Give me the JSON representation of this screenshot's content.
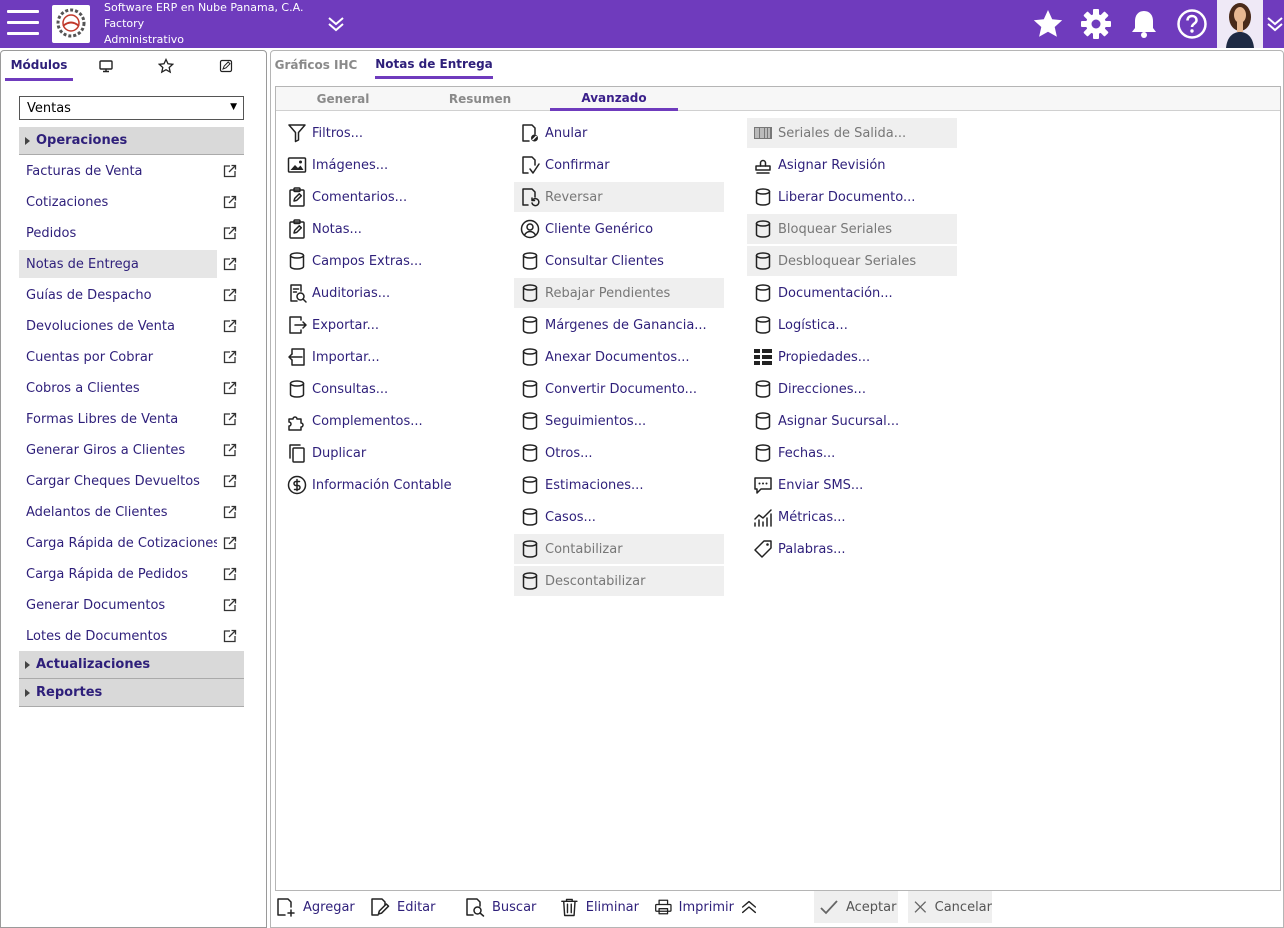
{
  "header": {
    "company_lines": [
      "Software ERP en Nube Panama, C.A.",
      "Factory",
      "Administrativo"
    ],
    "icons": [
      "menu-icon",
      "company-logo",
      "chevron-double-down-icon",
      "star-icon",
      "gear-icon",
      "bell-icon",
      "help-icon",
      "user-avatar",
      "chevron-double-down-icon"
    ],
    "bar_color": "#6f3bbd"
  },
  "left_panel": {
    "tabs": [
      {
        "label": "Módulos",
        "selected": true
      },
      {
        "icon": "monitor-icon"
      },
      {
        "icon": "star-outline-icon"
      },
      {
        "icon": "note-edit-icon"
      }
    ],
    "module_select": "Ventas",
    "sections": [
      {
        "label": "Operaciones",
        "expanded": true
      },
      {
        "label": "Actualizaciones",
        "expanded": false
      },
      {
        "label": "Reportes",
        "expanded": false
      }
    ],
    "items": [
      "Facturas de Venta",
      "Cotizaciones",
      "Pedidos",
      "Notas de Entrega",
      "Guías de Despacho",
      "Devoluciones de Venta",
      "Cuentas por Cobrar",
      "Cobros a Clientes",
      "Formas Libres de Venta",
      "Generar Giros a Clientes",
      "Cargar Cheques Devueltos",
      "Adelantos de Clientes",
      "Carga Rápida de Cotizaciones",
      "Carga Rápida de Pedidos",
      "Generar Documentos",
      "Lotes de Documentos"
    ],
    "selected_item": "Notas de Entrega"
  },
  "main": {
    "tabs": [
      {
        "label": "Gráficos IHC",
        "selected": false
      },
      {
        "label": "Notas de Entrega",
        "selected": true
      }
    ],
    "subtabs": [
      {
        "label": "General",
        "selected": false
      },
      {
        "label": "Resumen",
        "selected": false
      },
      {
        "label": "Avanzado",
        "selected": true
      }
    ],
    "columns": [
      [
        {
          "label": "Filtros...",
          "icon": "filter-icon",
          "disabled": false
        },
        {
          "label": "Imágenes...",
          "icon": "image-icon",
          "disabled": false
        },
        {
          "label": "Comentarios...",
          "icon": "clipboard-edit-icon",
          "disabled": false
        },
        {
          "label": "Notas...",
          "icon": "clipboard-edit-icon",
          "disabled": false
        },
        {
          "label": "Campos Extras...",
          "icon": "database-icon",
          "disabled": false
        },
        {
          "label": "Auditorias...",
          "icon": "audit-search-icon",
          "disabled": false
        },
        {
          "label": "Exportar...",
          "icon": "export-icon",
          "disabled": false
        },
        {
          "label": "Importar...",
          "icon": "import-icon",
          "disabled": false
        },
        {
          "label": "Consultas...",
          "icon": "database-icon",
          "disabled": false
        },
        {
          "label": "Complementos...",
          "icon": "puzzle-icon",
          "disabled": false
        },
        {
          "label": "Duplicar",
          "icon": "copy-icon",
          "disabled": false
        },
        {
          "label": "Información Contable",
          "icon": "dollar-circle-icon",
          "disabled": false
        }
      ],
      [
        {
          "label": "Anular",
          "icon": "document-cancel-icon",
          "disabled": false
        },
        {
          "label": "Confirmar",
          "icon": "document-check-icon",
          "disabled": false
        },
        {
          "label": "Reversar",
          "icon": "document-undo-icon",
          "disabled": true
        },
        {
          "label": "Cliente Genérico",
          "icon": "user-circle-icon",
          "disabled": false
        },
        {
          "label": "Consultar Clientes",
          "icon": "database-icon",
          "disabled": false
        },
        {
          "label": "Rebajar Pendientes",
          "icon": "database-icon",
          "disabled": true
        },
        {
          "label": "Márgenes de Ganancia...",
          "icon": "database-icon",
          "disabled": false
        },
        {
          "label": "Anexar Documentos...",
          "icon": "database-icon",
          "disabled": false
        },
        {
          "label": "Convertir Documento...",
          "icon": "database-icon",
          "disabled": false
        },
        {
          "label": "Seguimientos...",
          "icon": "database-icon",
          "disabled": false
        },
        {
          "label": "Otros...",
          "icon": "database-icon",
          "disabled": false
        },
        {
          "label": "Estimaciones...",
          "icon": "database-icon",
          "disabled": false
        },
        {
          "label": "Casos...",
          "icon": "database-icon",
          "disabled": false
        },
        {
          "label": "Contabilizar",
          "icon": "database-icon",
          "disabled": true
        },
        {
          "label": "Descontabilizar",
          "icon": "database-icon",
          "disabled": true
        }
      ],
      [
        {
          "label": "Seriales de Salida...",
          "icon": "barcode-icon",
          "disabled": true
        },
        {
          "label": "Asignar Revisión",
          "icon": "stamp-icon",
          "disabled": false
        },
        {
          "label": "Liberar Documento...",
          "icon": "database-icon",
          "disabled": false
        },
        {
          "label": "Bloquear Seriales",
          "icon": "database-icon",
          "disabled": true
        },
        {
          "label": "Desbloquear Seriales",
          "icon": "database-icon",
          "disabled": true
        },
        {
          "label": "Documentación...",
          "icon": "database-icon",
          "disabled": false
        },
        {
          "label": "Logística...",
          "icon": "database-icon",
          "disabled": false
        },
        {
          "label": "Propiedades...",
          "icon": "grid-list-icon",
          "disabled": false
        },
        {
          "label": "Direcciones...",
          "icon": "database-icon",
          "disabled": false
        },
        {
          "label": "Asignar Sucursal...",
          "icon": "database-icon",
          "disabled": false
        },
        {
          "label": "Fechas...",
          "icon": "database-icon",
          "disabled": false
        },
        {
          "label": "Enviar SMS...",
          "icon": "chat-icon",
          "disabled": false
        },
        {
          "label": "Métricas...",
          "icon": "chart-line-icon",
          "disabled": false
        },
        {
          "label": "Palabras...",
          "icon": "tag-icon",
          "disabled": false
        }
      ]
    ]
  },
  "bottom_bar": {
    "buttons": [
      {
        "label": "Agregar",
        "icon": "add-document-icon",
        "disabled": false
      },
      {
        "label": "Editar",
        "icon": "edit-document-icon",
        "disabled": false
      },
      {
        "label": "Buscar",
        "icon": "search-document-icon",
        "disabled": false
      },
      {
        "label": "Eliminar",
        "icon": "trash-icon",
        "disabled": false
      },
      {
        "label": "Imprimir",
        "icon": "printer-icon",
        "disabled": false
      },
      {
        "icon": "chevron-double-up-icon"
      },
      {
        "label": "Aceptar",
        "icon": "check-icon",
        "disabled": true
      },
      {
        "label": "Cancelar",
        "icon": "close-icon",
        "disabled": true
      }
    ]
  }
}
